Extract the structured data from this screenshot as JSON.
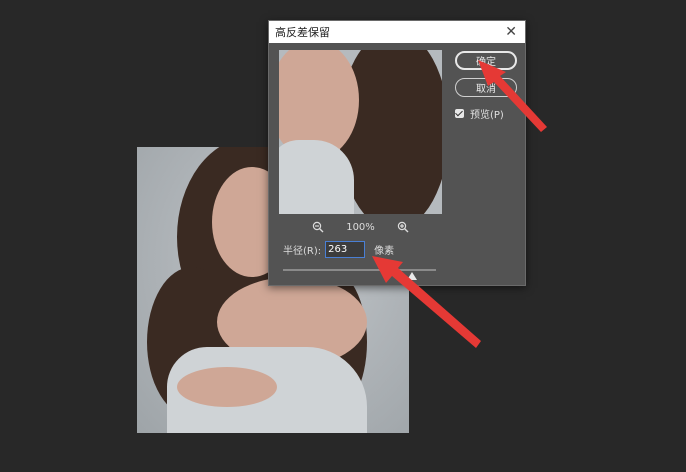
{
  "dialog": {
    "title": "高反差保留",
    "ok_label": "确定",
    "cancel_label": "取消",
    "preview_label": "预览(P)",
    "preview_checked": true,
    "zoom_level": "100%",
    "radius_label": "半径(R):",
    "radius_value": "263",
    "radius_unit": "像素"
  },
  "icons": {
    "close": "close-icon",
    "zoom_out": "zoom-out-icon",
    "zoom_in": "zoom-in-icon"
  },
  "colors": {
    "annotation_arrow": "#e53935",
    "dialog_bg": "#535353",
    "app_bg": "#282828"
  }
}
